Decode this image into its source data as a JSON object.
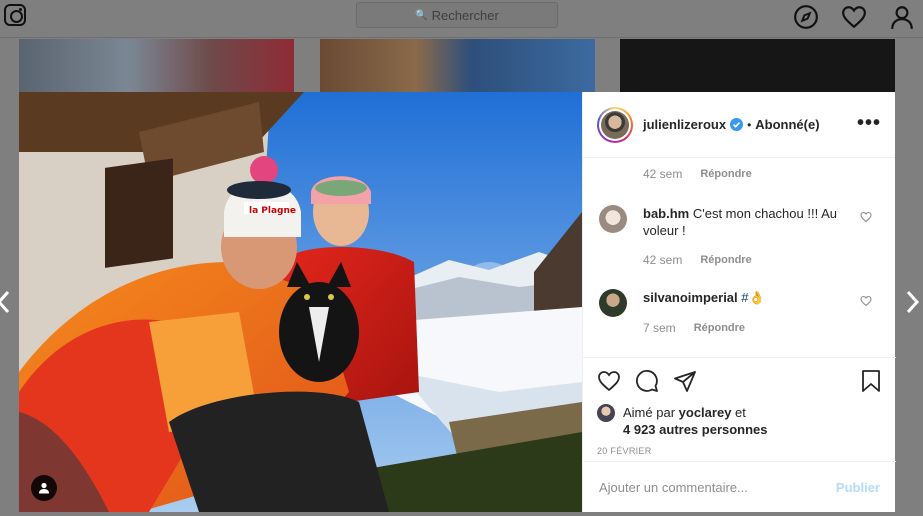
{
  "search": {
    "placeholder": "Rechercher"
  },
  "post": {
    "username": "julienlizeroux",
    "separator": "•",
    "follow_status": "Abonné(e)",
    "more_label": "•••"
  },
  "comments": {
    "first_meta": {
      "time": "42 sem",
      "reply": "Répondre"
    },
    "items": [
      {
        "username": "bab.hm",
        "text": "C'est mon chachou !!! Au voleur !",
        "time": "42 sem",
        "reply": "Répondre"
      },
      {
        "username": "silvanoimperial",
        "text": "#👌",
        "time": "7 sem",
        "reply": "Répondre"
      }
    ]
  },
  "likes": {
    "prefix": "Aimé par",
    "user": "yoclarey",
    "connector": "et",
    "others": "4 923 autres personnes"
  },
  "date": "20 FÉVRIER",
  "add_comment": {
    "placeholder": "Ajouter un commentaire...",
    "post_label": "Publier"
  },
  "colors": {
    "accent": "#0095f6",
    "post_disabled": "#b3dbff",
    "verified": "#3897f0"
  }
}
